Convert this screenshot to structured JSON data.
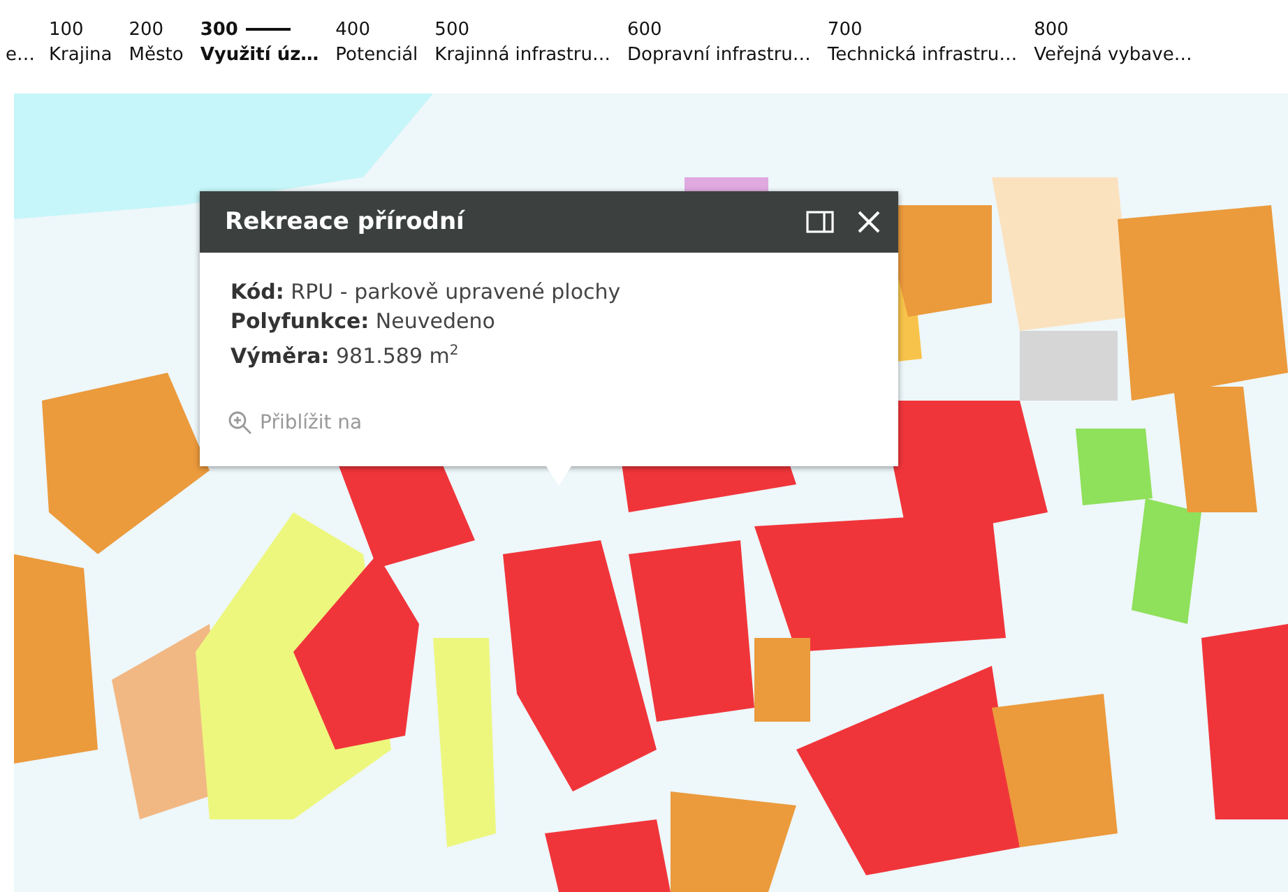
{
  "tabs": [
    {
      "label": "e…",
      "selected": false
    },
    {
      "code": "100",
      "label": "Krajina",
      "selected": false
    },
    {
      "code": "200",
      "label": "Město",
      "selected": false
    },
    {
      "code": "300",
      "label": "Využití úz…",
      "selected": true
    },
    {
      "code": "400",
      "label": "Potenciál",
      "selected": false
    },
    {
      "code": "500",
      "label": "Krajinná infrastru…",
      "selected": false
    },
    {
      "code": "600",
      "label": "Dopravní infrastru…",
      "selected": false
    },
    {
      "code": "700",
      "label": "Technická infrastru…",
      "selected": false
    },
    {
      "code": "800",
      "label": "Veřejná vybave…",
      "selected": false
    }
  ],
  "popup": {
    "title": "Rekreace přírodní",
    "fields": [
      {
        "label": "Kód:",
        "value": "RPU - parkově upravené plochy"
      },
      {
        "label": "Polyfunkce:",
        "value": "Neuvedeno"
      },
      {
        "label": "Výměra:",
        "value": "981.589 m$^{2}$"
      }
    ],
    "zoom_link": "Přiblížit na"
  }
}
